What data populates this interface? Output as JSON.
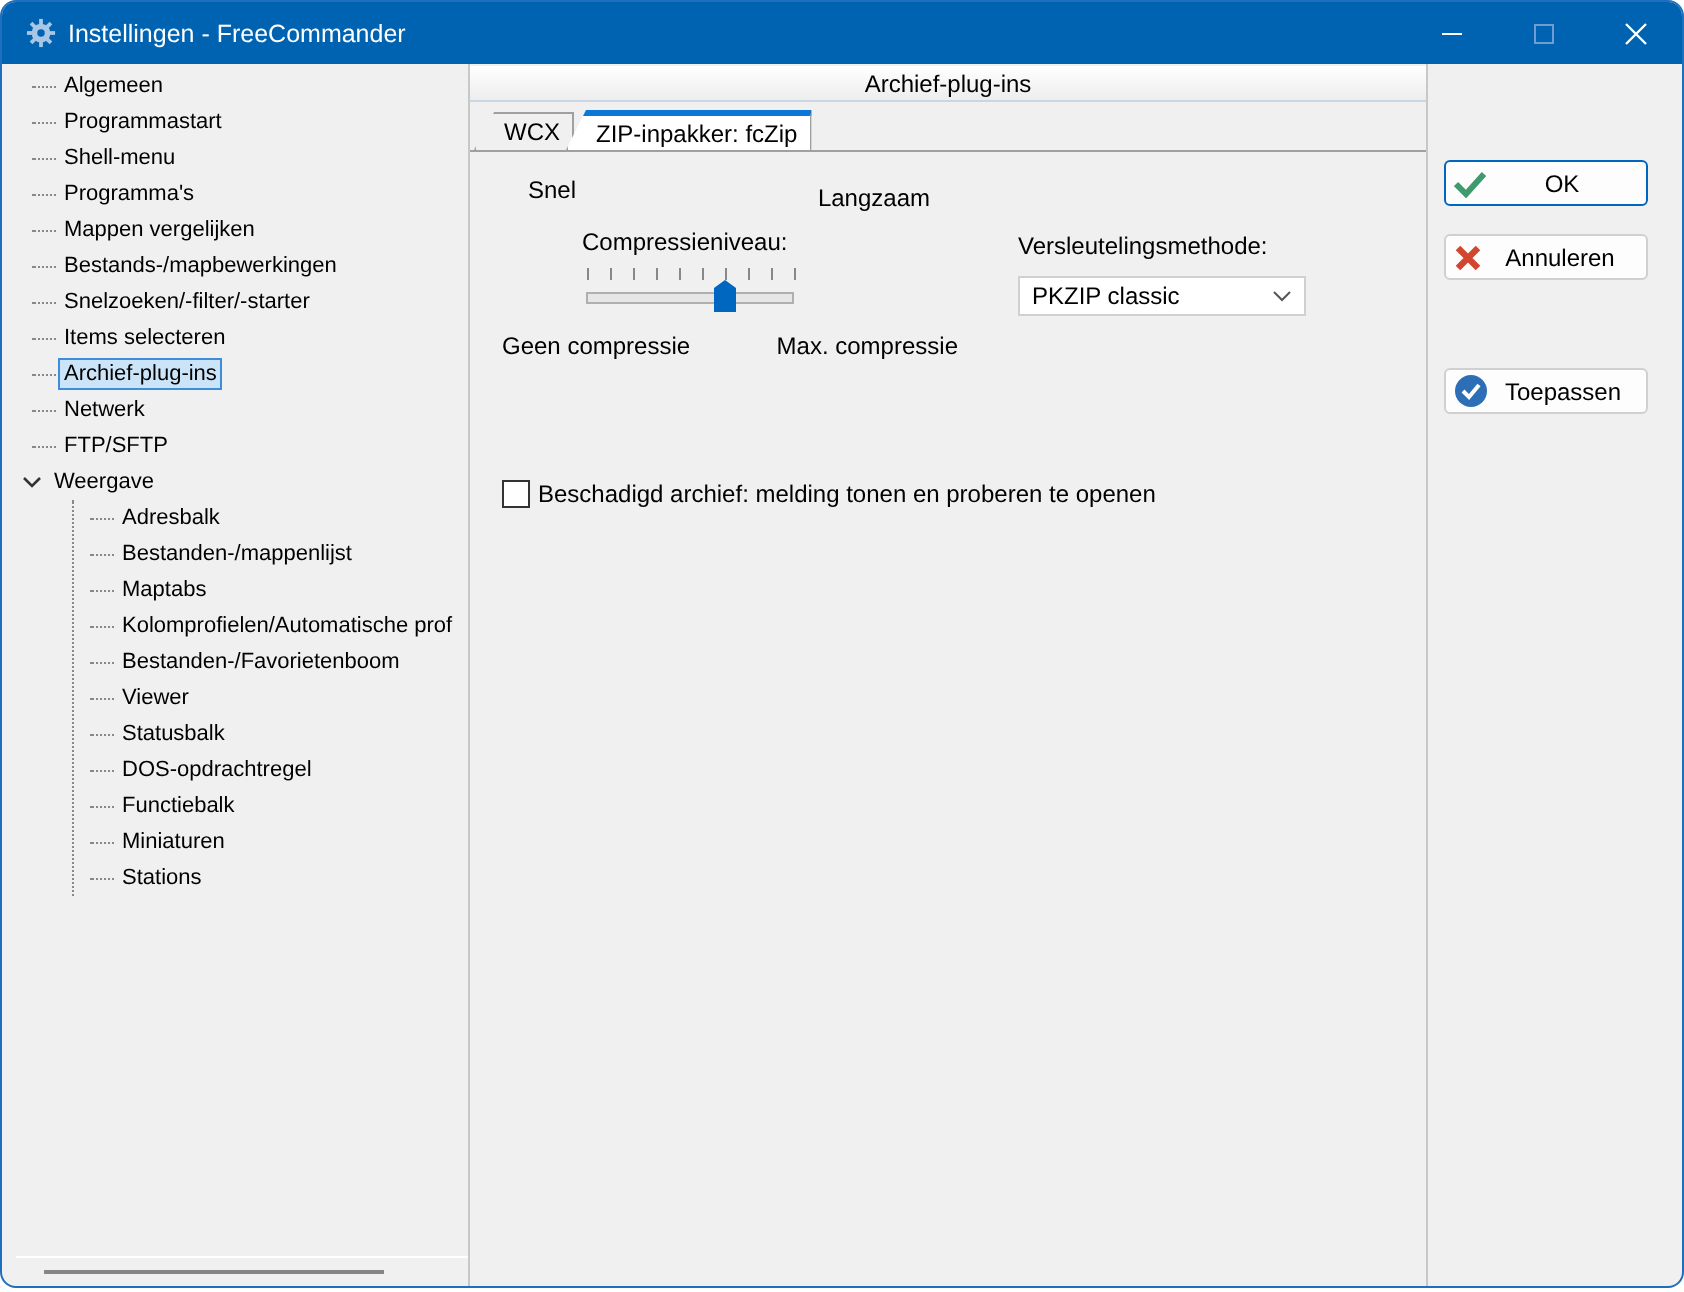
{
  "window": {
    "title": "Instellingen - FreeCommander"
  },
  "tree": [
    {
      "label": "Algemeen",
      "selected": false
    },
    {
      "label": "Programmastart",
      "selected": false
    },
    {
      "label": "Shell-menu",
      "selected": false
    },
    {
      "label": "Programma's",
      "selected": false
    },
    {
      "label": "Mappen vergelijken",
      "selected": false
    },
    {
      "label": "Bestands-/mapbewerkingen",
      "selected": false
    },
    {
      "label": "Snelzoeken/-filter/-starter",
      "selected": false
    },
    {
      "label": "Items selecteren",
      "selected": false
    },
    {
      "label": "Archief-plug-ins",
      "selected": true
    },
    {
      "label": "Netwerk",
      "selected": false
    },
    {
      "label": "FTP/SFTP",
      "selected": false
    },
    {
      "label": "Weergave",
      "selected": false,
      "expanded": true,
      "children": [
        {
          "label": "Adresbalk",
          "selected": false
        },
        {
          "label": "Bestanden-/mappenlijst",
          "selected": false
        },
        {
          "label": "Maptabs",
          "selected": false
        },
        {
          "label": "Kolomprofielen/Automatische prof",
          "selected": false
        },
        {
          "label": "Bestanden-/Favorietenboom",
          "selected": false
        },
        {
          "label": "Viewer",
          "selected": false
        },
        {
          "label": "Statusbalk",
          "selected": false
        },
        {
          "label": "DOS-opdrachtregel",
          "selected": false
        },
        {
          "label": "Functiebalk",
          "selected": false
        },
        {
          "label": "Miniaturen",
          "selected": false
        },
        {
          "label": "Stations",
          "selected": false
        }
      ]
    }
  ],
  "page_title": "Archief-plug-ins",
  "tabs": [
    {
      "label": "WCX",
      "selected": false
    },
    {
      "label": "ZIP-inpakker: fcZip",
      "selected": true
    }
  ],
  "compression": {
    "fast_label": "Snel",
    "slow_label": "Langzaam",
    "label": "Compressieniveau:",
    "level": 0.667,
    "min_label": "Geen compressie",
    "max_label": "Max. compressie"
  },
  "encryption": {
    "label": "Versleutelingsmethode:",
    "value": "PKZIP classic"
  },
  "damaged_archive": {
    "label": "Beschadigd archief: melding tonen en proberen te openen",
    "checked": false
  },
  "buttons": [
    {
      "label": "OK",
      "kind": "ok",
      "focused": true
    },
    {
      "label": "Annuleren",
      "kind": "cancel",
      "focused": false
    },
    {
      "label": "Toepassen",
      "kind": "apply",
      "focused": false
    }
  ]
}
